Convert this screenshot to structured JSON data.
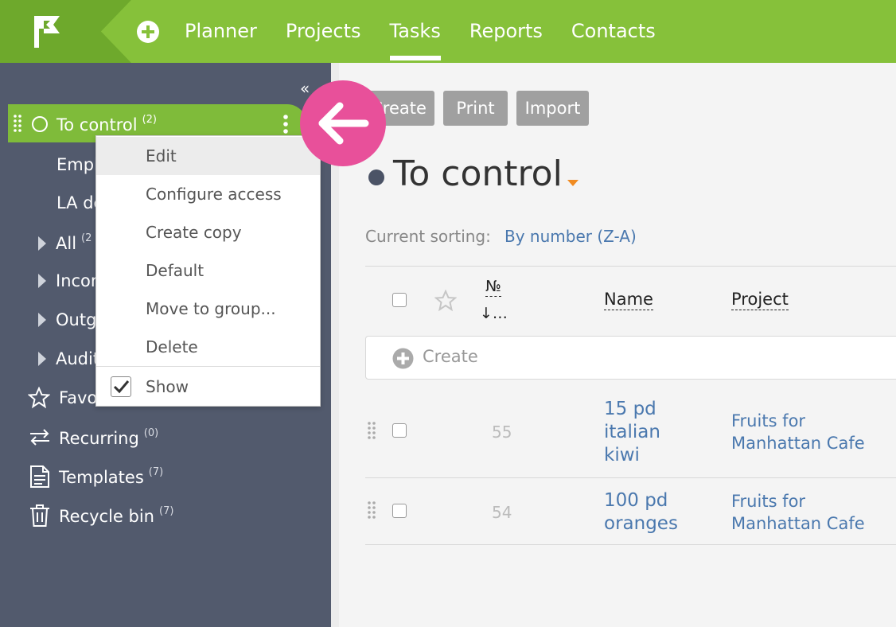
{
  "colors": {
    "topbar": "#86c13a",
    "logo_bg": "#6ea92c",
    "sidebar": "#525a6d",
    "active_item": "#7fbb3a",
    "accent_pink": "#e8509a",
    "link": "#4a78ae",
    "caret": "#f08b22",
    "button": "#a0a0a0"
  },
  "nav": {
    "items": [
      {
        "label": "Planner"
      },
      {
        "label": "Projects"
      },
      {
        "label": "Tasks",
        "active": true
      },
      {
        "label": "Reports"
      },
      {
        "label": "Contacts"
      }
    ]
  },
  "sidebar": {
    "active": {
      "label": "To control",
      "count": "(2)"
    },
    "items": [
      {
        "label": "Employees"
      },
      {
        "label": "LA delivery"
      },
      {
        "label": "All",
        "count": "(2"
      },
      {
        "label": "Incoming"
      },
      {
        "label": "Outgoing"
      },
      {
        "label": "Audit"
      },
      {
        "label": "Favorites"
      },
      {
        "label": "Recurring",
        "count": "(0)"
      },
      {
        "label": "Templates",
        "count": "(7)"
      },
      {
        "label": "Recycle bin",
        "count": "(7)"
      }
    ]
  },
  "context_menu": {
    "items": [
      {
        "label": "Edit"
      },
      {
        "label": "Configure access"
      },
      {
        "label": "Create copy"
      },
      {
        "label": "Default"
      },
      {
        "label": "Move to group..."
      },
      {
        "label": "Delete"
      }
    ],
    "show": {
      "label": "Show",
      "checked": true
    }
  },
  "toolbar": {
    "create_label": "Create",
    "print_label": "Print",
    "import_label": "Import"
  },
  "page": {
    "title": "To control",
    "sorting_label": "Current sorting:",
    "sorting_value": "By number (Z-A)"
  },
  "table": {
    "columns": {
      "number": "№",
      "number_sort": "↓…",
      "name": "Name",
      "project": "Project"
    },
    "create_label": "Create",
    "rows": [
      {
        "number": "55",
        "name_lines": [
          "15 pd",
          "italian",
          "kiwi"
        ],
        "project_lines": [
          "Fruits for",
          "Manhattan Cafe"
        ]
      },
      {
        "number": "54",
        "name_lines": [
          "100 pd",
          "oranges"
        ],
        "project_lines": [
          "Fruits for",
          "Manhattan Cafe"
        ]
      }
    ]
  }
}
